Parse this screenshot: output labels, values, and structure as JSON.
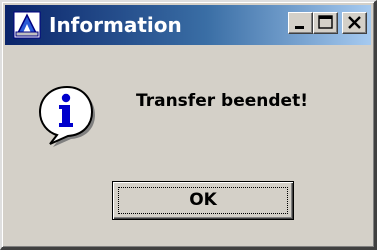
{
  "window": {
    "title": "Information",
    "icons": {
      "app": "app-icon",
      "minimize": "minimize-icon",
      "maximize": "maximize-icon",
      "close": "close-icon"
    },
    "colors": {
      "titlebar_start": "#0a246a",
      "titlebar_end": "#a6caf0",
      "face": "#d4d0c8"
    }
  },
  "dialog": {
    "message": "Transfer beendet!",
    "icon": "info-icon",
    "ok_label": "OK"
  }
}
